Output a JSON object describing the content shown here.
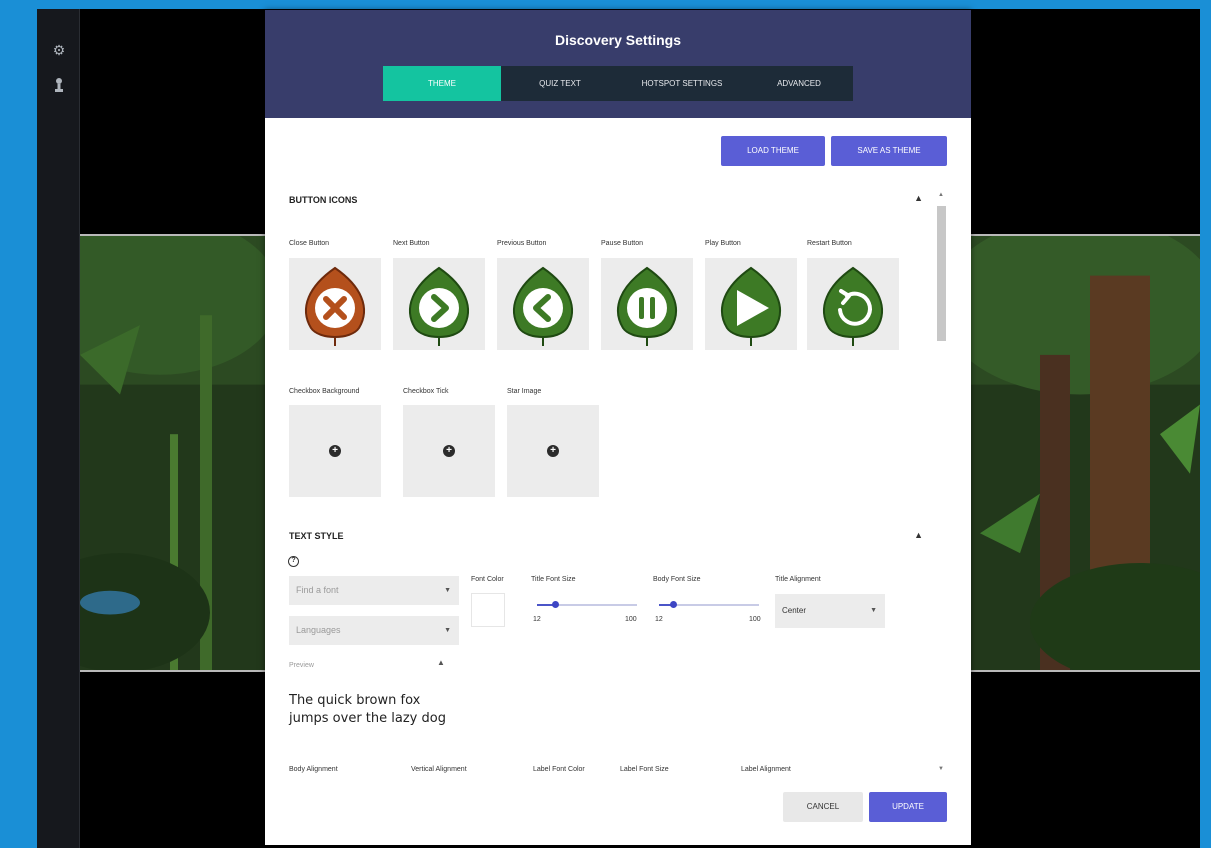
{
  "side_rail": {
    "icons": [
      "gear-icon",
      "person-icon"
    ]
  },
  "modal": {
    "title": "Discovery Settings",
    "tabs": [
      {
        "label": "THEME",
        "active": true
      },
      {
        "label": "QUIZ TEXT",
        "active": false
      },
      {
        "label": "HOTSPOT SETTINGS",
        "active": false
      },
      {
        "label": "ADVANCED",
        "active": false
      }
    ],
    "load_theme": "LOAD THEME",
    "save_as_theme": "SAVE AS THEME",
    "button_icons": {
      "title": "BUTTON ICONS",
      "icons": [
        {
          "label": "Close Button",
          "icon": "close-leaf-icon",
          "color": "#b4501c"
        },
        {
          "label": "Next Button",
          "icon": "next-leaf-icon",
          "color": "#3d7a25"
        },
        {
          "label": "Previous Button",
          "icon": "previous-leaf-icon",
          "color": "#3d7a25"
        },
        {
          "label": "Pause Button",
          "icon": "pause-leaf-icon",
          "color": "#3d7a25"
        },
        {
          "label": "Play Button",
          "icon": "play-leaf-icon",
          "color": "#3d7a25"
        },
        {
          "label": "Restart Button",
          "icon": "restart-leaf-icon",
          "color": "#3d7a25"
        }
      ],
      "uploads": [
        {
          "label": "Checkbox Background"
        },
        {
          "label": "Checkbox Tick"
        },
        {
          "label": "Star Image"
        }
      ]
    },
    "text_style": {
      "title": "TEXT STYLE",
      "font_placeholder": "Find a font",
      "languages_placeholder": "Languages",
      "font_color_label": "Font Color",
      "font_color": "#ffffff",
      "title_font_size": {
        "label": "Title Font Size",
        "min": "12",
        "max": "100",
        "value": 12
      },
      "body_font_size": {
        "label": "Body Font Size",
        "min": "12",
        "max": "100",
        "value": 12
      },
      "title_alignment": {
        "label": "Title Alignment",
        "value": "Center"
      },
      "preview_label": "Preview",
      "preview_text_line1": "The quick brown fox",
      "preview_text_line2": "jumps over the lazy dog",
      "body_alignment_label": "Body Alignment",
      "vertical_alignment_label": "Vertical Alignment",
      "label_font_color_label": "Label Font Color",
      "label_font_size_label": "Label Font Size",
      "label_alignment_label": "Label Alignment"
    },
    "cancel": "CANCEL",
    "update": "UPDATE"
  },
  "colors": {
    "header": "#383d6b",
    "tab_active": "#14c4a0",
    "primary_button": "#5a5ed6",
    "frame_border": "#1a8fd6"
  }
}
